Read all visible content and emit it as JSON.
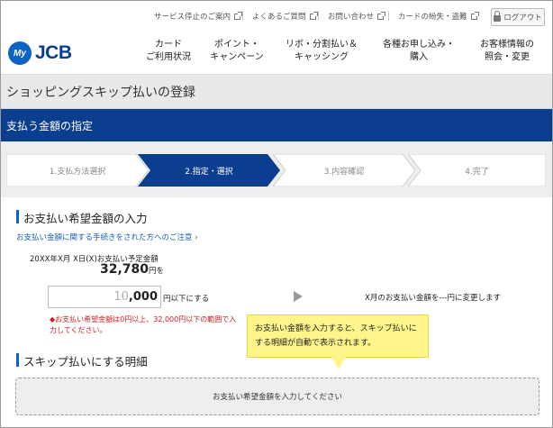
{
  "util_links": [
    {
      "label": "サービス停止のご案内"
    },
    {
      "label": "よくあるご質問"
    },
    {
      "label": "お問い合わせ"
    },
    {
      "label": "カードの紛失・盗難"
    }
  ],
  "logout_label": "ログアウト",
  "logo": {
    "my": "My",
    "brand": "JCB"
  },
  "nav": [
    {
      "label": "カード\nご利用状況"
    },
    {
      "label": "ポイント・\nキャンペーン"
    },
    {
      "label": "リボ・分割払い＆\nキャッシング"
    },
    {
      "label": "各種お申し込み・\n購入"
    },
    {
      "label": "お客様情報の\n照会・変更"
    }
  ],
  "page_title": "ショッピングスキップ払いの登録",
  "section_title": "支払う金額の指定",
  "steps": [
    {
      "label": "1.支払方法選択",
      "active": false
    },
    {
      "label": "2.指定・選択",
      "active": true
    },
    {
      "label": "3.内容確認",
      "active": false
    },
    {
      "label": "4.完了",
      "active": false
    }
  ],
  "payment": {
    "heading": "お支払い希望金額の入力",
    "notice_link": "お支払い金額に関する手続きをされた方へのご注意",
    "due_label": "20XX年X月 X日(X)お支払い予定金額",
    "due_amount": "32,780",
    "due_suffix": "円を",
    "input_placeholder": "10",
    "input_value": ",000",
    "input_suffix": "円以下にする",
    "change_text": "X月のお支払い金額を---円に変更します",
    "note": "◆お支払い希望金額は0円以上、32,000円以下の範囲で入力してください。"
  },
  "skip": {
    "heading": "スキップ払いにする明細",
    "empty_message": "お支払い希望金額を入力してください"
  },
  "tooltip": "お支払い金額を入力すると、スキップ払いにする明細が自動で表示されます。"
}
